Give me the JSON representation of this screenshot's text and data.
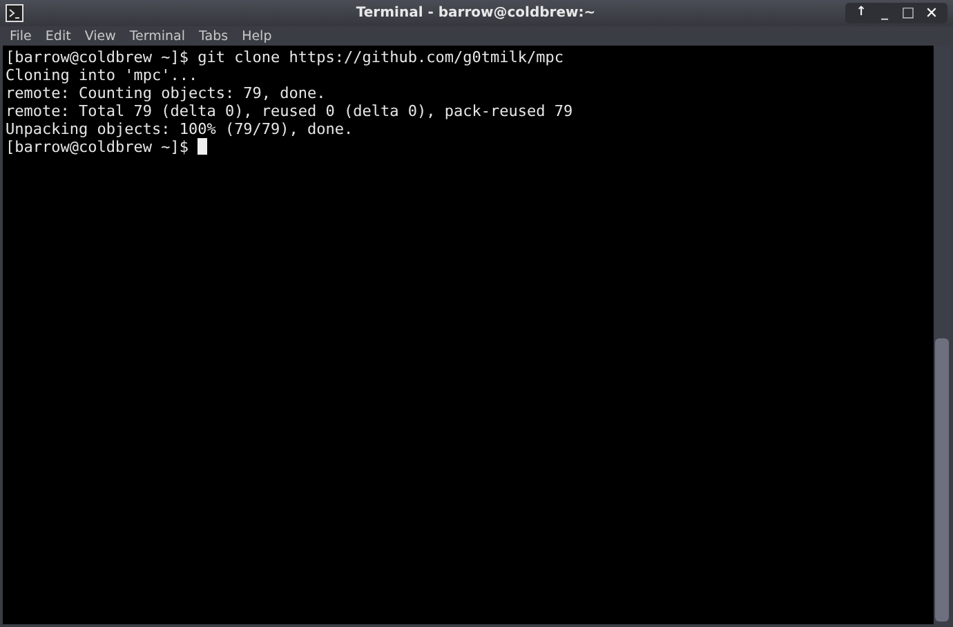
{
  "window": {
    "title": "Terminal - barrow@coldbrew:~",
    "controls": [
      {
        "kind": "up",
        "label": "↑"
      },
      {
        "kind": "minimize",
        "label": "_"
      },
      {
        "kind": "maximize",
        "label": "□"
      },
      {
        "kind": "close",
        "label": "✕"
      }
    ]
  },
  "menu": [
    "File",
    "Edit",
    "View",
    "Terminal",
    "Tabs",
    "Help"
  ],
  "terminal": {
    "lines": [
      "[barrow@coldbrew ~]$ git clone https://github.com/g0tmilk/mpc",
      "Cloning into 'mpc'...",
      "remote: Counting objects: 79, done.",
      "remote: Total 79 (delta 0), reused 0 (delta 0), pack-reused 79",
      "Unpacking objects: 100% (79/79), done."
    ],
    "prompt": "[barrow@coldbrew ~]$ "
  }
}
